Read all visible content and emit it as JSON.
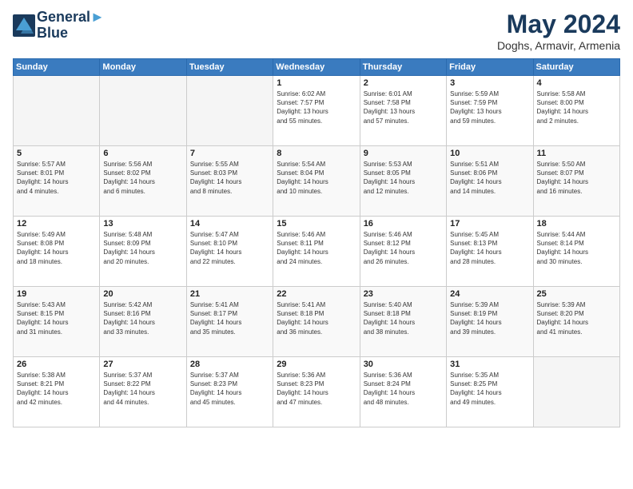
{
  "header": {
    "logo_line1": "General",
    "logo_line2": "Blue",
    "month": "May 2024",
    "location": "Doghs, Armavir, Armenia"
  },
  "weekdays": [
    "Sunday",
    "Monday",
    "Tuesday",
    "Wednesday",
    "Thursday",
    "Friday",
    "Saturday"
  ],
  "weeks": [
    [
      {
        "day": "",
        "info": ""
      },
      {
        "day": "",
        "info": ""
      },
      {
        "day": "",
        "info": ""
      },
      {
        "day": "1",
        "info": "Sunrise: 6:02 AM\nSunset: 7:57 PM\nDaylight: 13 hours\nand 55 minutes."
      },
      {
        "day": "2",
        "info": "Sunrise: 6:01 AM\nSunset: 7:58 PM\nDaylight: 13 hours\nand 57 minutes."
      },
      {
        "day": "3",
        "info": "Sunrise: 5:59 AM\nSunset: 7:59 PM\nDaylight: 13 hours\nand 59 minutes."
      },
      {
        "day": "4",
        "info": "Sunrise: 5:58 AM\nSunset: 8:00 PM\nDaylight: 14 hours\nand 2 minutes."
      }
    ],
    [
      {
        "day": "5",
        "info": "Sunrise: 5:57 AM\nSunset: 8:01 PM\nDaylight: 14 hours\nand 4 minutes."
      },
      {
        "day": "6",
        "info": "Sunrise: 5:56 AM\nSunset: 8:02 PM\nDaylight: 14 hours\nand 6 minutes."
      },
      {
        "day": "7",
        "info": "Sunrise: 5:55 AM\nSunset: 8:03 PM\nDaylight: 14 hours\nand 8 minutes."
      },
      {
        "day": "8",
        "info": "Sunrise: 5:54 AM\nSunset: 8:04 PM\nDaylight: 14 hours\nand 10 minutes."
      },
      {
        "day": "9",
        "info": "Sunrise: 5:53 AM\nSunset: 8:05 PM\nDaylight: 14 hours\nand 12 minutes."
      },
      {
        "day": "10",
        "info": "Sunrise: 5:51 AM\nSunset: 8:06 PM\nDaylight: 14 hours\nand 14 minutes."
      },
      {
        "day": "11",
        "info": "Sunrise: 5:50 AM\nSunset: 8:07 PM\nDaylight: 14 hours\nand 16 minutes."
      }
    ],
    [
      {
        "day": "12",
        "info": "Sunrise: 5:49 AM\nSunset: 8:08 PM\nDaylight: 14 hours\nand 18 minutes."
      },
      {
        "day": "13",
        "info": "Sunrise: 5:48 AM\nSunset: 8:09 PM\nDaylight: 14 hours\nand 20 minutes."
      },
      {
        "day": "14",
        "info": "Sunrise: 5:47 AM\nSunset: 8:10 PM\nDaylight: 14 hours\nand 22 minutes."
      },
      {
        "day": "15",
        "info": "Sunrise: 5:46 AM\nSunset: 8:11 PM\nDaylight: 14 hours\nand 24 minutes."
      },
      {
        "day": "16",
        "info": "Sunrise: 5:46 AM\nSunset: 8:12 PM\nDaylight: 14 hours\nand 26 minutes."
      },
      {
        "day": "17",
        "info": "Sunrise: 5:45 AM\nSunset: 8:13 PM\nDaylight: 14 hours\nand 28 minutes."
      },
      {
        "day": "18",
        "info": "Sunrise: 5:44 AM\nSunset: 8:14 PM\nDaylight: 14 hours\nand 30 minutes."
      }
    ],
    [
      {
        "day": "19",
        "info": "Sunrise: 5:43 AM\nSunset: 8:15 PM\nDaylight: 14 hours\nand 31 minutes."
      },
      {
        "day": "20",
        "info": "Sunrise: 5:42 AM\nSunset: 8:16 PM\nDaylight: 14 hours\nand 33 minutes."
      },
      {
        "day": "21",
        "info": "Sunrise: 5:41 AM\nSunset: 8:17 PM\nDaylight: 14 hours\nand 35 minutes."
      },
      {
        "day": "22",
        "info": "Sunrise: 5:41 AM\nSunset: 8:18 PM\nDaylight: 14 hours\nand 36 minutes."
      },
      {
        "day": "23",
        "info": "Sunrise: 5:40 AM\nSunset: 8:18 PM\nDaylight: 14 hours\nand 38 minutes."
      },
      {
        "day": "24",
        "info": "Sunrise: 5:39 AM\nSunset: 8:19 PM\nDaylight: 14 hours\nand 39 minutes."
      },
      {
        "day": "25",
        "info": "Sunrise: 5:39 AM\nSunset: 8:20 PM\nDaylight: 14 hours\nand 41 minutes."
      }
    ],
    [
      {
        "day": "26",
        "info": "Sunrise: 5:38 AM\nSunset: 8:21 PM\nDaylight: 14 hours\nand 42 minutes."
      },
      {
        "day": "27",
        "info": "Sunrise: 5:37 AM\nSunset: 8:22 PM\nDaylight: 14 hours\nand 44 minutes."
      },
      {
        "day": "28",
        "info": "Sunrise: 5:37 AM\nSunset: 8:23 PM\nDaylight: 14 hours\nand 45 minutes."
      },
      {
        "day": "29",
        "info": "Sunrise: 5:36 AM\nSunset: 8:23 PM\nDaylight: 14 hours\nand 47 minutes."
      },
      {
        "day": "30",
        "info": "Sunrise: 5:36 AM\nSunset: 8:24 PM\nDaylight: 14 hours\nand 48 minutes."
      },
      {
        "day": "31",
        "info": "Sunrise: 5:35 AM\nSunset: 8:25 PM\nDaylight: 14 hours\nand 49 minutes."
      },
      {
        "day": "",
        "info": ""
      }
    ]
  ]
}
